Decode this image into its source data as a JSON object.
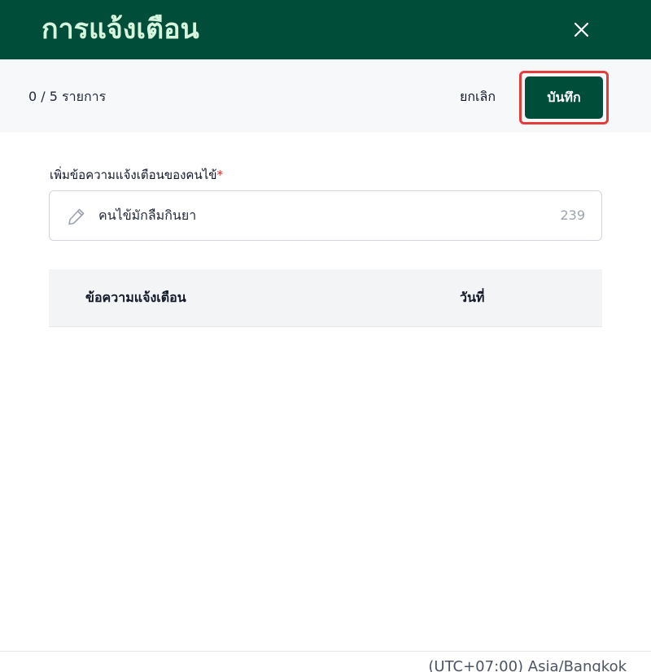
{
  "header": {
    "title": "การแจ้งเตือน",
    "close_icon": "close-icon",
    "background_color": "#004d3a",
    "title_color": "#d6f5dd"
  },
  "toolbar": {
    "count_text": "0 / 5 รายการ",
    "cancel_label": "ยกเลิก",
    "save_label": "บันทึก",
    "save_button_color": "#004d3a",
    "highlight_color": "#e23c3c"
  },
  "form": {
    "field_label": "เพิ่มข้อความแจ้งเตือนของคนไข้",
    "required_marker": "*",
    "input_icon": "pencil-icon",
    "input_value": "คนไข้มักลืมกินยา",
    "char_counter": "239"
  },
  "table": {
    "columns": [
      "ข้อความแจ้งเตือน",
      "วันที่"
    ],
    "rows": []
  },
  "footer": {
    "timezone": "(UTC+07:00) Asia/Bangkok"
  }
}
